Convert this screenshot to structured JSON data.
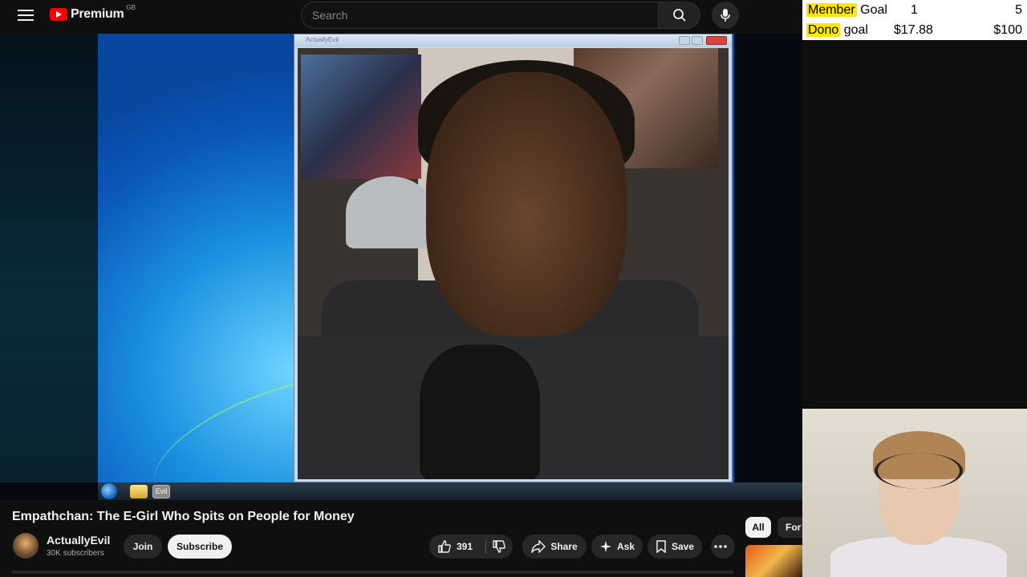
{
  "header": {
    "brand": "Premium",
    "region": "GB",
    "search_placeholder": "Search"
  },
  "goals": {
    "member": {
      "label_hl": "Member",
      "label_rest": " Goal",
      "current": "1",
      "target": "5"
    },
    "dono": {
      "label_hl": "Dono",
      "label_rest": " goal",
      "current": "$17.88",
      "target": "$100"
    }
  },
  "player": {
    "window_title": "ActuallyEvil",
    "taskbar_app": "Evil"
  },
  "video": {
    "title": "Empathchan: The E-Girl Who Spits on People for Money",
    "channel": "ActuallyEvil",
    "subscribers": "30K subscribers"
  },
  "actions": {
    "join": "Join",
    "subscribe": "Subscribe",
    "likes": "391",
    "share": "Share",
    "ask": "Ask",
    "save": "Save"
  },
  "chips": {
    "all": "All",
    "for_you": "For y"
  },
  "icons": [
    "menu-icon",
    "youtube-logo-icon",
    "search-icon",
    "mic-icon",
    "like-icon",
    "dislike-icon",
    "share-icon",
    "ask-sparkle-icon",
    "save-icon",
    "more-icon"
  ],
  "colors": {
    "accent": "#ff0000",
    "goal_highlight": "#ffe600",
    "background": "#0f0f0f"
  }
}
